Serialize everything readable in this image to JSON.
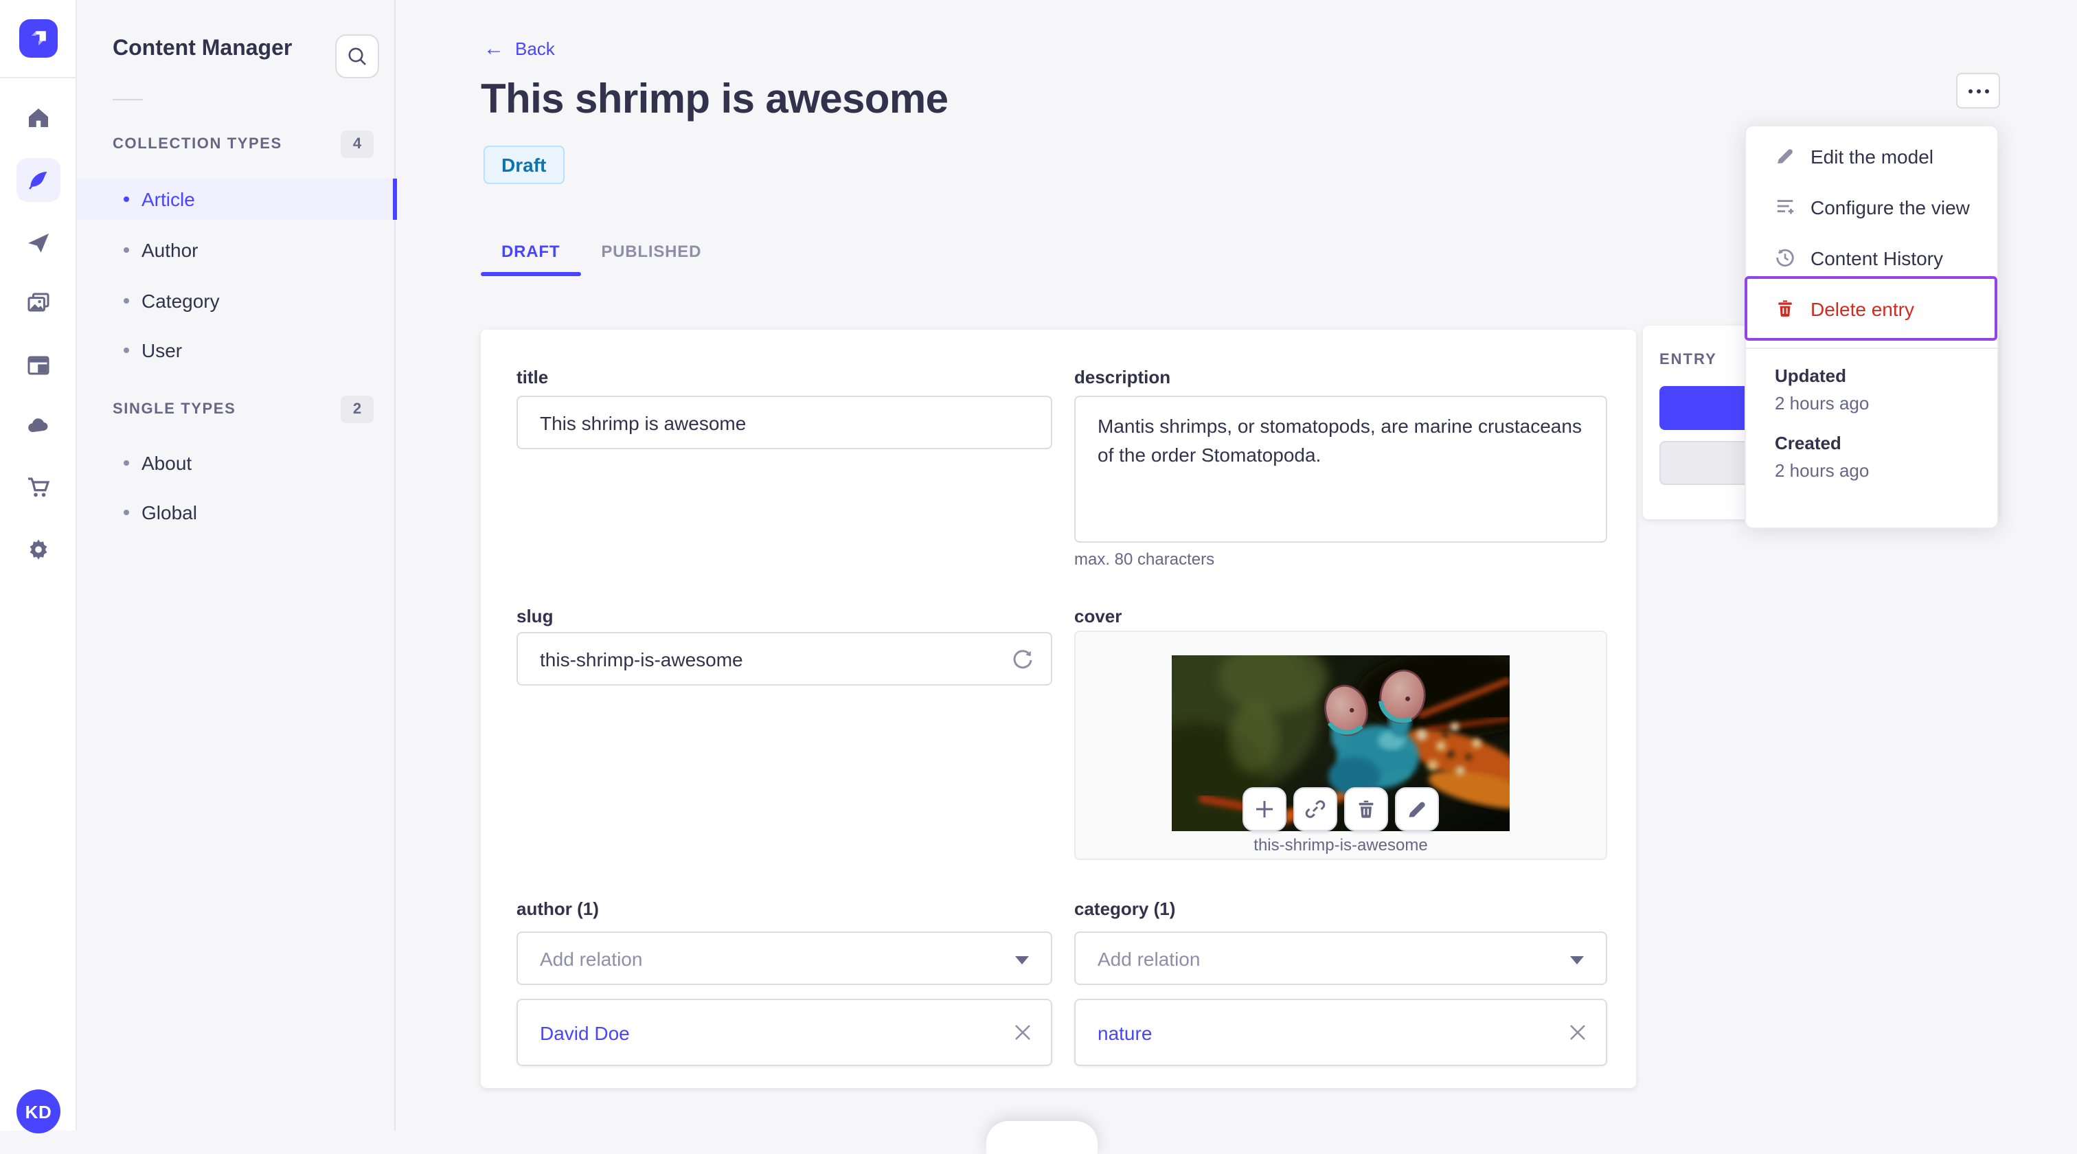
{
  "colors": {
    "accent": "#4945ff",
    "accent_bg": "#f0f0ff",
    "danger": "#d02b20",
    "annotation_purple": "#9245e6",
    "status_badge_bg": "#eaf5ff",
    "status_badge_border": "#b8e1ff",
    "status_badge_text": "#0c75af",
    "page_bg": "#f6f6f9"
  },
  "rail": {
    "icons": [
      "strapi-logo-icon",
      "home-icon",
      "feather-icon",
      "send-icon",
      "media-icon",
      "layout-icon",
      "cloud-icon",
      "cart-icon",
      "gear-icon"
    ],
    "active_icon": "feather-icon",
    "avatar_initials": "KD"
  },
  "subnav": {
    "title": "Content Manager",
    "search_icon": "search-icon",
    "sections": [
      {
        "label": "COLLECTION TYPES",
        "badge": "4",
        "items": [
          {
            "label": "Article",
            "active": true
          },
          {
            "label": "Author",
            "active": false
          },
          {
            "label": "Category",
            "active": false
          },
          {
            "label": "User",
            "active": false
          }
        ]
      },
      {
        "label": "SINGLE TYPES",
        "badge": "2",
        "items": [
          {
            "label": "About",
            "active": false
          },
          {
            "label": "Global",
            "active": false
          }
        ]
      }
    ]
  },
  "header": {
    "back_label": "Back",
    "back_icon": "arrow-left-icon",
    "title": "This shrimp is awesome",
    "status": "Draft",
    "tabs": [
      {
        "label": "DRAFT",
        "active": true
      },
      {
        "label": "PUBLISHED",
        "active": false
      }
    ],
    "more_icon": "more-horizontal-icon"
  },
  "form": {
    "title": {
      "label": "title",
      "value": "This shrimp is awesome"
    },
    "description": {
      "label": "description",
      "value": "Mantis shrimps, or stomatopods, are marine crustaceans of the order Stomatopoda.",
      "helper": "max. 80 characters"
    },
    "slug": {
      "label": "slug",
      "value": "this-shrimp-is-awesome",
      "action_icon": "refresh-icon"
    },
    "cover": {
      "label": "cover",
      "caption": "this-shrimp-is-awesome",
      "image_alt": "mantis shrimp photo",
      "action_icons": [
        "plus-icon",
        "link-icon",
        "trash-icon",
        "pencil-icon"
      ]
    },
    "author": {
      "label": "author (1)",
      "placeholder": "Add relation",
      "relation": "David Doe",
      "remove_icon": "close-icon"
    },
    "category": {
      "label": "category (1)",
      "placeholder": "Add relation",
      "relation": "nature",
      "remove_icon": "close-icon"
    }
  },
  "entry_panel": {
    "heading": "ENTRY"
  },
  "menu": {
    "items": [
      {
        "label": "Edit the model",
        "icon": "pencil-icon",
        "danger": false
      },
      {
        "label": "Configure the view",
        "icon": "configure-list-icon",
        "danger": false
      },
      {
        "label": "Content History",
        "icon": "history-icon",
        "danger": false
      },
      {
        "label": "Delete entry",
        "icon": "trash-icon",
        "danger": true,
        "highlighted": true
      }
    ],
    "meta": [
      {
        "label": "Updated",
        "value": "2 hours ago"
      },
      {
        "label": "Created",
        "value": "2 hours ago"
      }
    ]
  }
}
